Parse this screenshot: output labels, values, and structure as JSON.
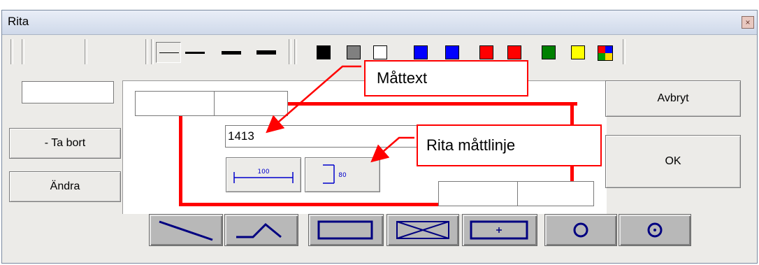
{
  "window": {
    "title": "Rita",
    "close_glyph": "×"
  },
  "toolbar": {
    "line_styles": [
      "thin-line",
      "medium-line",
      "thick-line",
      "thicker-line"
    ],
    "colors": [
      "#000000",
      "#808080",
      "#ffffff",
      "#0000ff",
      "#0000ff",
      "#ff0000",
      "#ff0000",
      "#008000",
      "#ffff00"
    ],
    "multicolor_icon": "multicolor-palette-icon"
  },
  "left": {
    "text_value": "",
    "remove_label": "- Ta bort",
    "edit_label": "Ändra"
  },
  "right": {
    "cancel_label": "Avbryt",
    "ok_label": "OK"
  },
  "dimension": {
    "value": "1413",
    "horizontal_label": "100",
    "vertical_label": "80"
  },
  "callouts": {
    "text_label": "Måttext",
    "line_label": "Rita måttlinje"
  },
  "draw_tools": [
    "line-tool-icon",
    "polyline-tool-icon",
    "rectangle-tool-icon",
    "crossed-rectangle-tool-icon",
    "plus-rectangle-tool-icon",
    "circle-tool-icon",
    "circle-dot-tool-icon"
  ],
  "accent_color": "#ff0000"
}
